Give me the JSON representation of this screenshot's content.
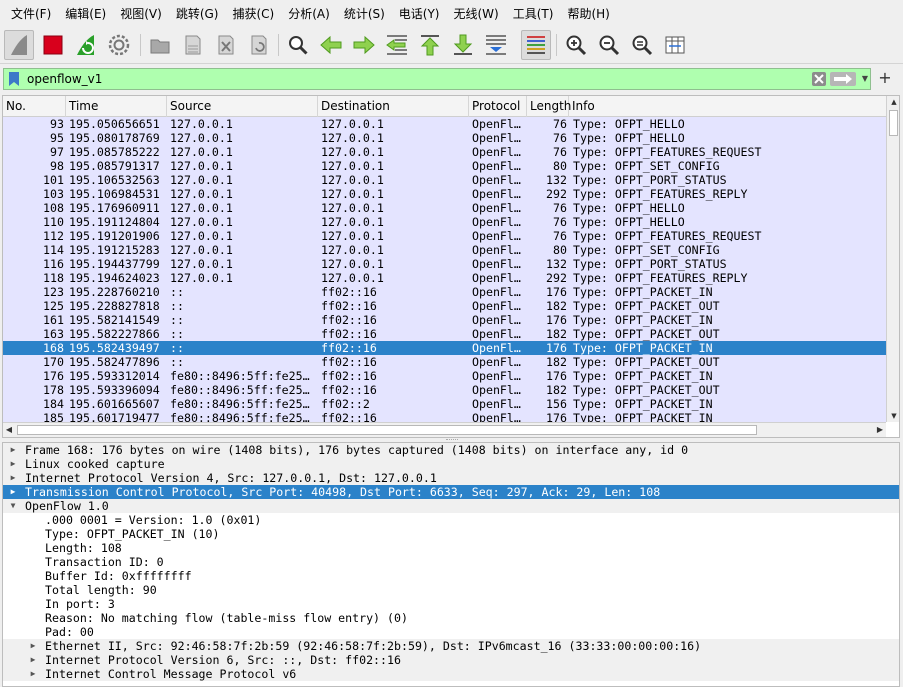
{
  "menu": [
    "文件(F)",
    "编辑(E)",
    "视图(V)",
    "跳转(G)",
    "捕获(C)",
    "分析(A)",
    "统计(S)",
    "电话(Y)",
    "无线(W)",
    "工具(T)",
    "帮助(H)"
  ],
  "toolbar": {
    "buttons": [
      {
        "name": "start-capture-icon"
      },
      {
        "name": "stop-capture-icon"
      },
      {
        "name": "restart-capture-icon"
      },
      {
        "name": "capture-options-icon"
      },
      {
        "name": "open-file-icon"
      },
      {
        "name": "save-file-icon"
      },
      {
        "name": "close-file-icon"
      },
      {
        "name": "reload-file-icon"
      },
      {
        "name": "find-packet-icon"
      },
      {
        "name": "go-back-icon"
      },
      {
        "name": "go-forward-icon"
      },
      {
        "name": "go-to-packet-icon"
      },
      {
        "name": "go-first-packet-icon"
      },
      {
        "name": "go-last-packet-icon"
      },
      {
        "name": "auto-scroll-icon"
      },
      {
        "name": "colorize-icon"
      },
      {
        "name": "zoom-in-icon"
      },
      {
        "name": "zoom-out-icon"
      },
      {
        "name": "zoom-normal-icon"
      },
      {
        "name": "resize-columns-icon"
      }
    ]
  },
  "filter": {
    "value": "openflow_v1",
    "background": "#afffaf"
  },
  "packet_list": {
    "columns": [
      "No.",
      "Time",
      "Source",
      "Destination",
      "Protocol",
      "Length",
      "Info"
    ],
    "rows": [
      {
        "no": "93",
        "time": "195.050656651",
        "src": "127.0.0.1",
        "dst": "127.0.0.1",
        "proto": "OpenFl…",
        "len": "76",
        "info": "Type: OFPT_HELLO"
      },
      {
        "no": "95",
        "time": "195.080178769",
        "src": "127.0.0.1",
        "dst": "127.0.0.1",
        "proto": "OpenFl…",
        "len": "76",
        "info": "Type: OFPT_HELLO"
      },
      {
        "no": "97",
        "time": "195.085785222",
        "src": "127.0.0.1",
        "dst": "127.0.0.1",
        "proto": "OpenFl…",
        "len": "76",
        "info": "Type: OFPT_FEATURES_REQUEST"
      },
      {
        "no": "98",
        "time": "195.085791317",
        "src": "127.0.0.1",
        "dst": "127.0.0.1",
        "proto": "OpenFl…",
        "len": "80",
        "info": "Type: OFPT_SET_CONFIG"
      },
      {
        "no": "101",
        "time": "195.106532563",
        "src": "127.0.0.1",
        "dst": "127.0.0.1",
        "proto": "OpenFl…",
        "len": "132",
        "info": "Type: OFPT_PORT_STATUS"
      },
      {
        "no": "103",
        "time": "195.106984531",
        "src": "127.0.0.1",
        "dst": "127.0.0.1",
        "proto": "OpenFl…",
        "len": "292",
        "info": "Type: OFPT_FEATURES_REPLY"
      },
      {
        "no": "108",
        "time": "195.176960911",
        "src": "127.0.0.1",
        "dst": "127.0.0.1",
        "proto": "OpenFl…",
        "len": "76",
        "info": "Type: OFPT_HELLO"
      },
      {
        "no": "110",
        "time": "195.191124804",
        "src": "127.0.0.1",
        "dst": "127.0.0.1",
        "proto": "OpenFl…",
        "len": "76",
        "info": "Type: OFPT_HELLO"
      },
      {
        "no": "112",
        "time": "195.191201906",
        "src": "127.0.0.1",
        "dst": "127.0.0.1",
        "proto": "OpenFl…",
        "len": "76",
        "info": "Type: OFPT_FEATURES_REQUEST"
      },
      {
        "no": "114",
        "time": "195.191215283",
        "src": "127.0.0.1",
        "dst": "127.0.0.1",
        "proto": "OpenFl…",
        "len": "80",
        "info": "Type: OFPT_SET_CONFIG"
      },
      {
        "no": "116",
        "time": "195.194437799",
        "src": "127.0.0.1",
        "dst": "127.0.0.1",
        "proto": "OpenFl…",
        "len": "132",
        "info": "Type: OFPT_PORT_STATUS"
      },
      {
        "no": "118",
        "time": "195.194624023",
        "src": "127.0.0.1",
        "dst": "127.0.0.1",
        "proto": "OpenFl…",
        "len": "292",
        "info": "Type: OFPT_FEATURES_REPLY"
      },
      {
        "no": "123",
        "time": "195.228760210",
        "src": "::",
        "dst": "ff02::16",
        "proto": "OpenFl…",
        "len": "176",
        "info": "Type: OFPT_PACKET_IN"
      },
      {
        "no": "125",
        "time": "195.228827818",
        "src": "::",
        "dst": "ff02::16",
        "proto": "OpenFl…",
        "len": "182",
        "info": "Type: OFPT_PACKET_OUT"
      },
      {
        "no": "161",
        "time": "195.582141549",
        "src": "::",
        "dst": "ff02::16",
        "proto": "OpenFl…",
        "len": "176",
        "info": "Type: OFPT_PACKET_IN"
      },
      {
        "no": "163",
        "time": "195.582227866",
        "src": "::",
        "dst": "ff02::16",
        "proto": "OpenFl…",
        "len": "182",
        "info": "Type: OFPT_PACKET_OUT"
      },
      {
        "no": "168",
        "time": "195.582439497",
        "src": "::",
        "dst": "ff02::16",
        "proto": "OpenFl…",
        "len": "176",
        "info": "Type: OFPT_PACKET_IN",
        "selected": true
      },
      {
        "no": "170",
        "time": "195.582477896",
        "src": "::",
        "dst": "ff02::16",
        "proto": "OpenFl…",
        "len": "182",
        "info": "Type: OFPT_PACKET_OUT"
      },
      {
        "no": "176",
        "time": "195.593312014",
        "src": "fe80::8496:5ff:fe25…",
        "dst": "ff02::16",
        "proto": "OpenFl…",
        "len": "176",
        "info": "Type: OFPT_PACKET_IN"
      },
      {
        "no": "178",
        "time": "195.593396094",
        "src": "fe80::8496:5ff:fe25…",
        "dst": "ff02::16",
        "proto": "OpenFl…",
        "len": "182",
        "info": "Type: OFPT_PACKET_OUT"
      },
      {
        "no": "184",
        "time": "195.601665607",
        "src": "fe80::8496:5ff:fe25…",
        "dst": "ff02::2",
        "proto": "OpenFl…",
        "len": "156",
        "info": "Type: OFPT_PACKET_IN"
      },
      {
        "no": "185",
        "time": "195.601719477",
        "src": "fe80::8496:5ff:fe25…",
        "dst": "ff02::16",
        "proto": "OpenFl…",
        "len": "176",
        "info": "Type: OFPT_PACKET_IN"
      }
    ],
    "row_color": "#e4e4ff",
    "selected_color": "#2b82c9"
  },
  "details": [
    {
      "level": 0,
      "arrow": "right",
      "text": "Frame 168: 176 bytes on wire (1408 bits), 176 bytes captured (1408 bits) on interface any, id 0"
    },
    {
      "level": 0,
      "arrow": "right",
      "text": "Linux cooked capture"
    },
    {
      "level": 0,
      "arrow": "right",
      "text": "Internet Protocol Version 4, Src: 127.0.0.1, Dst: 127.0.0.1"
    },
    {
      "level": 0,
      "arrow": "right",
      "text": "Transmission Control Protocol, Src Port: 40498, Dst Port: 6633, Seq: 297, Ack: 29, Len: 108",
      "selected": true
    },
    {
      "level": 0,
      "arrow": "down",
      "text": "OpenFlow 1.0"
    },
    {
      "level": 1,
      "arrow": "",
      "text": ".000 0001 = Version: 1.0 (0x01)"
    },
    {
      "level": 1,
      "arrow": "",
      "text": "Type: OFPT_PACKET_IN (10)"
    },
    {
      "level": 1,
      "arrow": "",
      "text": "Length: 108"
    },
    {
      "level": 1,
      "arrow": "",
      "text": "Transaction ID: 0"
    },
    {
      "level": 1,
      "arrow": "",
      "text": "Buffer Id: 0xffffffff"
    },
    {
      "level": 1,
      "arrow": "",
      "text": "Total length: 90"
    },
    {
      "level": 1,
      "arrow": "",
      "text": "In port: 3"
    },
    {
      "level": 1,
      "arrow": "",
      "text": "Reason: No matching flow (table-miss flow entry) (0)"
    },
    {
      "level": 1,
      "arrow": "",
      "text": "Pad: 00"
    },
    {
      "level": 1,
      "arrow": "right",
      "text": "Ethernet II, Src: 92:46:58:7f:2b:59 (92:46:58:7f:2b:59), Dst: IPv6mcast_16 (33:33:00:00:00:16)"
    },
    {
      "level": 1,
      "arrow": "right",
      "text": "Internet Protocol Version 6, Src: ::, Dst: ff02::16"
    },
    {
      "level": 1,
      "arrow": "right",
      "text": "Internet Control Message Protocol v6"
    }
  ]
}
